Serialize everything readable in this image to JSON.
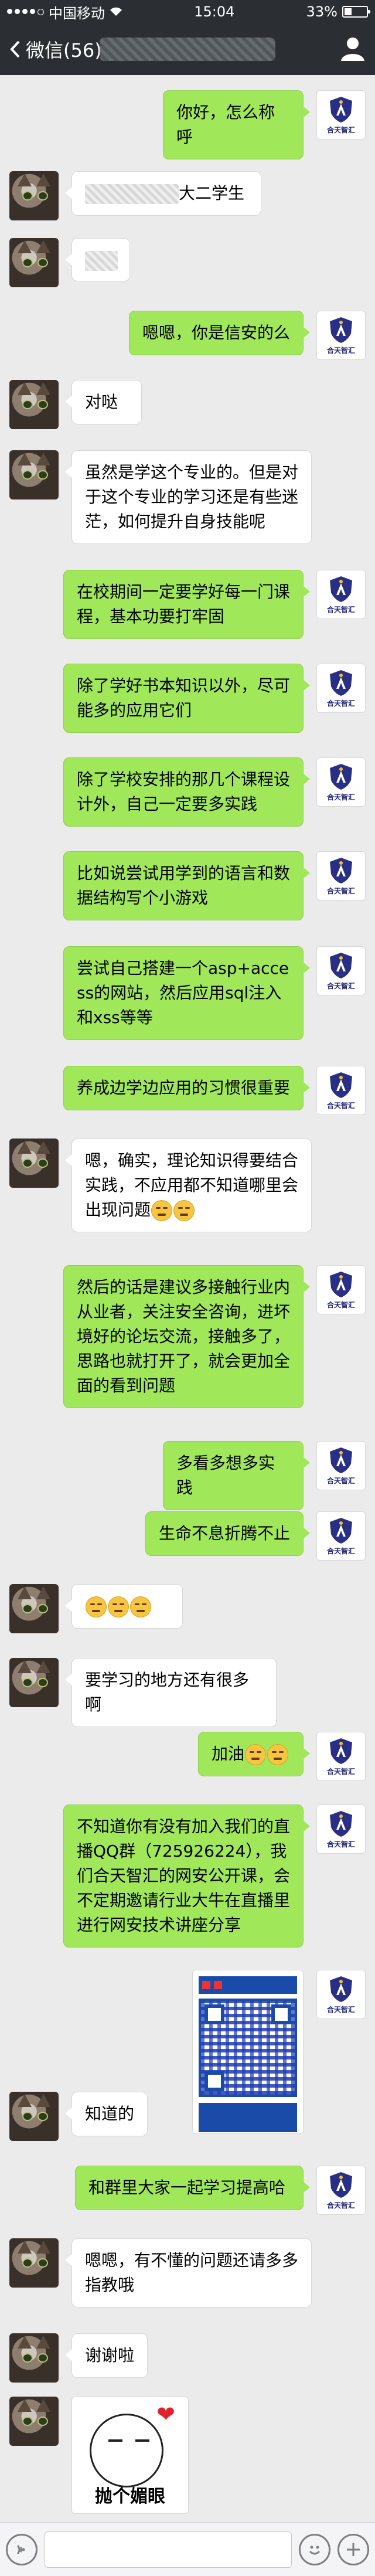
{
  "status_bar": {
    "carrier": "中国移动",
    "network_icon": "wifi-icon",
    "time": "15:04",
    "battery_percent": "33%",
    "battery_level": 0.33
  },
  "nav": {
    "back_label": "微信(56)",
    "back_icon": "chevron-left-icon",
    "profile_icon": "person-icon"
  },
  "messages": [
    {
      "side": "right",
      "avatar": "logo",
      "text": "你好，怎么称呼"
    },
    {
      "side": "left",
      "avatar": "cat",
      "text": "大二学生"
    },
    {
      "side": "left",
      "avatar": "cat",
      "text": ""
    },
    {
      "side": "right",
      "avatar": "logo",
      "text": "嗯嗯，你是信安的么"
    },
    {
      "side": "left",
      "avatar": "cat",
      "text": "对哒"
    },
    {
      "side": "left",
      "avatar": "cat",
      "text": "虽然是学这个专业的。但是对于这个专业的学习还是有些迷茫，如何提升自身技能呢"
    },
    {
      "side": "right",
      "avatar": "logo",
      "text": "在校期间一定要学好每一门课程，基本功要打牢固"
    },
    {
      "side": "right",
      "avatar": "logo",
      "text": "除了学好书本知识以外，尽可能多的应用它们"
    },
    {
      "side": "right",
      "avatar": "logo",
      "text": "除了学校安排的那几个课程设计外，自己一定要多实践"
    },
    {
      "side": "right",
      "avatar": "logo",
      "text": "比如说尝试用学到的语言和数据结构写个小游戏"
    },
    {
      "side": "right",
      "avatar": "logo",
      "text": "尝试自己搭建一个asp+access的网站，然后应用sql注入和xss等等"
    },
    {
      "side": "right",
      "avatar": "logo",
      "text": "养成边学边应用的习惯很重要"
    },
    {
      "side": "left",
      "avatar": "cat",
      "text": "嗯，确实，理论知识得要结合实践，不应用都不知道哪里会出现问题"
    },
    {
      "side": "right",
      "avatar": "logo",
      "text": "然后的话是建议多接触行业内从业者，关注安全咨询，进坏境好的论坛交流，接触多了，思路也就打开了，就会更加全面的看到问题"
    },
    {
      "side": "right",
      "avatar": "logo",
      "text": "多看多想多实践"
    },
    {
      "side": "right",
      "avatar": "logo",
      "text": "生命不息折腾不止"
    },
    {
      "side": "left",
      "avatar": "cat",
      "text": ""
    },
    {
      "side": "left",
      "avatar": "cat",
      "text": "要学习的地方还有很多啊"
    },
    {
      "side": "right",
      "avatar": "logo",
      "text": "加油"
    },
    {
      "side": "right",
      "avatar": "logo",
      "text": "不知道你有没有加入我们的直播QQ群（725926224），我们合天智汇的网安公开课，会不定期邀请行业大牛在直播里进行网安技术讲座分享"
    },
    {
      "side": "left",
      "avatar": "cat",
      "text": "知道的"
    },
    {
      "side": "right",
      "avatar": "logo",
      "text": "和群里大家一起学习提高哈"
    },
    {
      "side": "left",
      "avatar": "cat",
      "text": "嗯嗯，有不懂的问题还请多多指教哦"
    },
    {
      "side": "left",
      "avatar": "cat",
      "text": "谢谢啦"
    }
  ],
  "logo_text": "合天智汇",
  "sticker_caption": "抛个媚眼",
  "input_bar": {
    "voice_icon": "voice-icon",
    "emoji_icon": "emoji-icon",
    "plus_icon": "plus-icon"
  }
}
